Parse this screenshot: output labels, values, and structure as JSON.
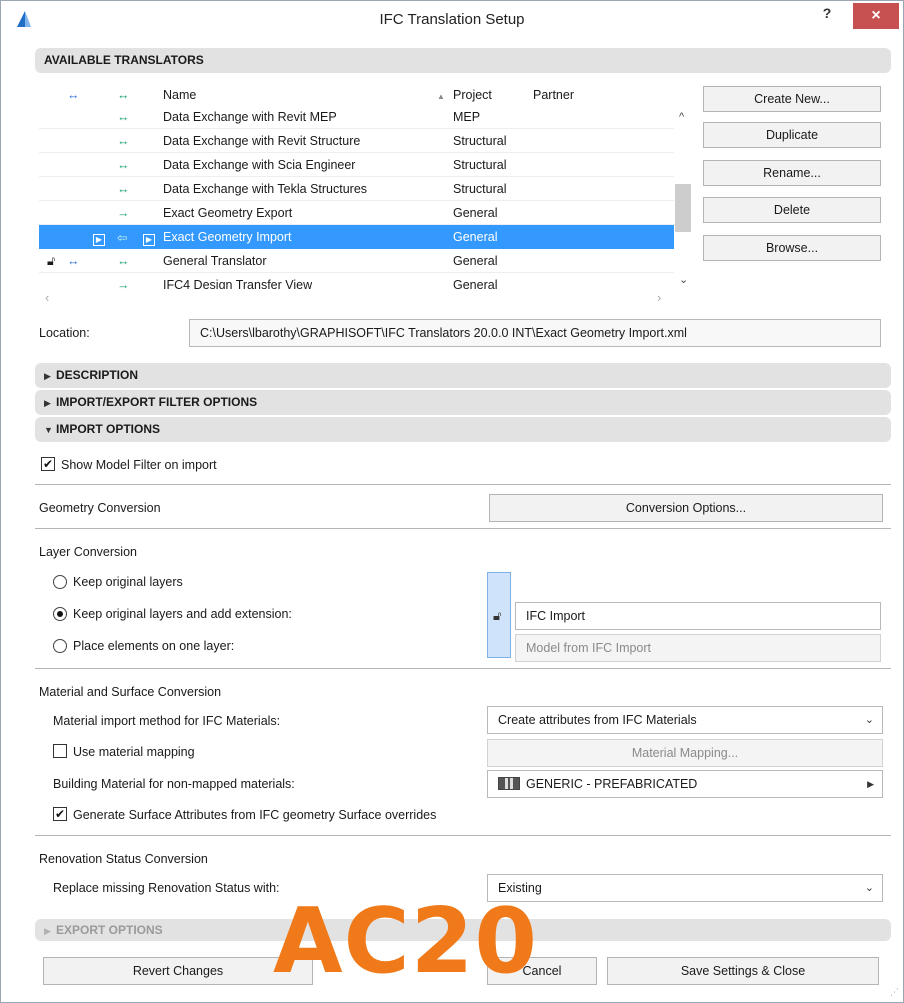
{
  "window": {
    "title": "IFC Translation Setup",
    "help_label": "?",
    "close_label": "×"
  },
  "translators": {
    "header": "AVAILABLE TRANSLATORS",
    "columns": {
      "name": "Name",
      "project": "Project",
      "partner": "Partner",
      "sort_glyph": "▲"
    },
    "rows": [
      {
        "name": "Data Exchange with Revit MEP",
        "project": "MEP",
        "partner": "",
        "arrow": "↔"
      },
      {
        "name": "Data Exchange with Revit Structure",
        "project": "Structural",
        "partner": "",
        "arrow": "↔"
      },
      {
        "name": "Data Exchange with Scia Engineer",
        "project": "Structural",
        "partner": "",
        "arrow": "↔"
      },
      {
        "name": "Data Exchange with Tekla Structures",
        "project": "Structural",
        "partner": "",
        "arrow": "↔"
      },
      {
        "name": "Exact Geometry Export",
        "project": "General",
        "partner": "",
        "arrow": "→"
      },
      {
        "name": "Exact Geometry Import",
        "project": "General",
        "partner": "",
        "arrow": "⇦"
      },
      {
        "name": "General Translator",
        "project": "General",
        "partner": "",
        "arrow": "↔"
      },
      {
        "name": "IFC4 Design Transfer View",
        "project": "General",
        "partner": "",
        "arrow": "→"
      }
    ],
    "buttons": {
      "create_new": "Create New...",
      "duplicate": "Duplicate",
      "rename": "Rename...",
      "delete": "Delete",
      "browse": "Browse..."
    }
  },
  "location": {
    "label": "Location:",
    "value": "C:\\Users\\lbarothy\\GRAPHISOFT\\IFC Translators 20.0.0 INT\\Exact Geometry Import.xml"
  },
  "sections": {
    "description": "DESCRIPTION",
    "filter_options": "IMPORT/EXPORT FILTER OPTIONS",
    "import_options": "IMPORT OPTIONS",
    "export_options": "EXPORT OPTIONS"
  },
  "import_options": {
    "show_model_filter": {
      "label": "Show Model Filter on import",
      "checked": true
    },
    "geometry_conversion": {
      "label": "Geometry Conversion",
      "button": "Conversion Options..."
    },
    "layer_conversion": {
      "title": "Layer Conversion",
      "options": [
        "Keep original layers",
        "Keep original layers and add extension:",
        "Place elements on one layer:"
      ],
      "selected_index": 1,
      "extension_value": "IFC Import",
      "one_layer_value": "Model from IFC Import"
    },
    "material_conversion": {
      "title": "Material and Surface Conversion",
      "method_label": "Material import method for IFC Materials:",
      "method_value": "Create attributes from IFC Materials",
      "use_mapping_label": "Use material mapping",
      "use_mapping_checked": false,
      "mapping_button": "Material Mapping...",
      "building_material_label": "Building Material for non-mapped materials:",
      "building_material_value": "GENERIC - PREFABRICATED",
      "generate_surface_label": "Generate Surface Attributes from IFC geometry Surface overrides",
      "generate_surface_checked": true
    },
    "renovation": {
      "title": "Renovation Status Conversion",
      "replace_label": "Replace missing Renovation Status with:",
      "replace_value": "Existing"
    }
  },
  "footer": {
    "revert": "Revert Changes",
    "cancel": "Cancel",
    "save": "Save Settings & Close"
  },
  "watermark": "AC20",
  "colors": {
    "selection": "#3399ff",
    "watermark": "#f07a1a",
    "close": "#c75050"
  }
}
